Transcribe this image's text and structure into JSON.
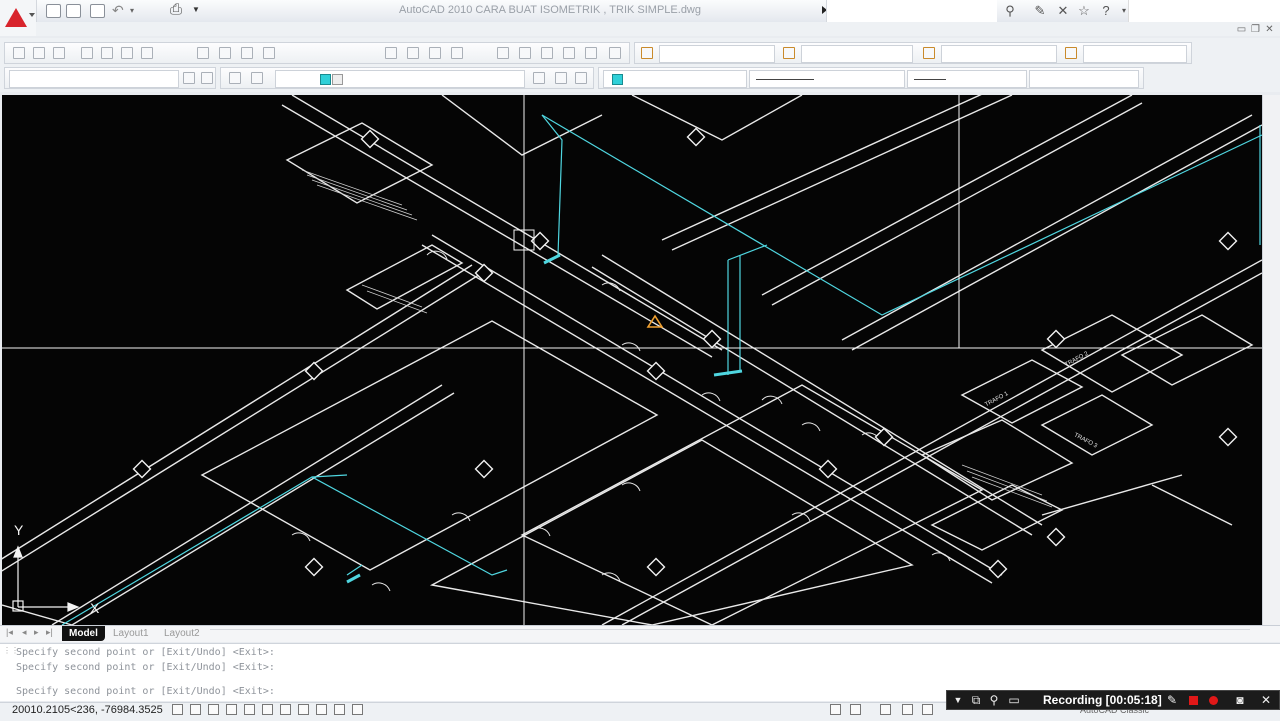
{
  "window": {
    "title": "AutoCAD 2010     CARA BUAT ISOMETRIK , TRIK SIMPLE.dwg"
  },
  "tabs": {
    "model": "Model",
    "layout1": "Layout1",
    "layout2": "Layout2"
  },
  "command_history": [
    "Specify second point or [Exit/Undo] <Exit>:",
    "Specify second point or [Exit/Undo] <Exit>:",
    "Specify second point or [Exit/Undo] <Exit>:"
  ],
  "status": {
    "coordinates": "20010.2105<236, -76984.3525"
  },
  "workspace": {
    "name": "AutoCAD Classic"
  },
  "recording": {
    "label": "Recording [00:05:18]"
  },
  "ucs": {
    "x_label": "X",
    "y_label": "Y"
  },
  "drawing_labels": {
    "trafo1": "TRAFO 1",
    "trafo2": "TRAFO 2",
    "trafo3": "TRAFO 3"
  },
  "colors": {
    "canvas": "#050505",
    "linework": "#e8e8e8",
    "cyan_lines": "#4fd6e0",
    "orange_marker": "#f0a030",
    "recording_red": "#e01818"
  },
  "icons": {
    "app_logo": "autocad-logo-icon",
    "help": "help-icon",
    "search": "binoculars-icon",
    "favorites": "star-icon"
  }
}
